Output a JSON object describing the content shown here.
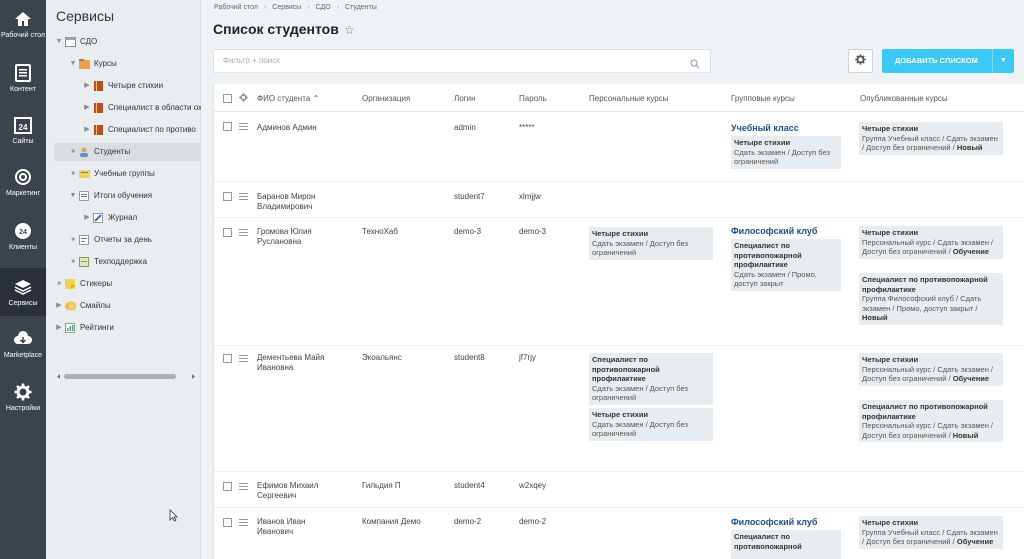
{
  "rail": [
    {
      "label": "Рабочий стол",
      "icon": "home-icon"
    },
    {
      "label": "Контент",
      "icon": "document-icon"
    },
    {
      "label": "Сайты",
      "icon": "calendar-24-icon"
    },
    {
      "label": "Маркетинг",
      "icon": "target-icon"
    },
    {
      "label": "Клиенты",
      "icon": "clients-24-icon"
    },
    {
      "label": "Сервисы",
      "icon": "layers-icon"
    },
    {
      "label": "Marketplace",
      "icon": "cloud-download-icon"
    },
    {
      "label": "Настройки",
      "icon": "gear-icon"
    }
  ],
  "tree": {
    "title": "Сервисы",
    "items": [
      {
        "label": "СДО",
        "icon": "module-icon"
      },
      {
        "label": "Курсы",
        "icon": "folder-icon"
      },
      {
        "label": "Четыре стихии",
        "icon": "book-icon"
      },
      {
        "label": "Специалист в области ох",
        "icon": "book-icon"
      },
      {
        "label": "Специалист по противо",
        "icon": "book-icon"
      },
      {
        "label": "Студенты",
        "icon": "user-icon"
      },
      {
        "label": "Учебные группы",
        "icon": "group-icon"
      },
      {
        "label": "Итоги обучения",
        "icon": "results-icon"
      },
      {
        "label": "Журнал",
        "icon": "journal-icon"
      },
      {
        "label": "Отчеты за день",
        "icon": "report-icon"
      },
      {
        "label": "Техподдержка",
        "icon": "support-icon"
      },
      {
        "label": "Стикеры",
        "icon": "sticker-icon"
      },
      {
        "label": "Смайлы",
        "icon": "smile-icon"
      },
      {
        "label": "Рейтинги",
        "icon": "rating-icon"
      }
    ]
  },
  "breadcrumbs": [
    "Рабочий стол",
    "Сервисы",
    "СДО",
    "Студенты"
  ],
  "page_title": "Список студентов",
  "filter_placeholder": "Фильтр + поиск",
  "add_button": "ДОБАВИТЬ СПИСКОМ",
  "columns": [
    "ФИО студента",
    "Организация",
    "Логин",
    "Пароль",
    "Персональные курсы",
    "Групповые курсы",
    "Опубликованные курсы"
  ],
  "rows": [
    {
      "name": "Админов Админ",
      "org": "",
      "login": "admin",
      "password": "*****",
      "personal": [],
      "group_title": "Учебный класс",
      "group": [
        {
          "title": "Четыре стихии",
          "text": "Сдать экзамен / Доступ без ограничений"
        }
      ],
      "published": [
        {
          "title": "Четыре стихии",
          "text": "Группа Учебный класс / Сдать экзамен / Доступ без ограничений /",
          "status": "Новый"
        }
      ]
    },
    {
      "name": "Баранов Мирон Владимирович",
      "org": "",
      "login": "student7",
      "password": "xlmjjw",
      "personal": [],
      "group_title": "",
      "group": [],
      "published": []
    },
    {
      "name": "Громова Юлия Руслановна",
      "org": "ТехноХаб",
      "login": "demo-3",
      "password": "demo-3",
      "personal": [
        {
          "title": "Четыре стихии",
          "text": "Сдать экзамен / Доступ без ограничений"
        }
      ],
      "group_title": "Философский клуб",
      "group": [
        {
          "title": "Специалист по противопожарной профилактике",
          "text": "Сдать экзамен / Промо, доступ закрыт"
        }
      ],
      "published": [
        {
          "title": "Четыре стихии",
          "text": "Персональный курс / Сдать экзамен / Доступ без ограничений /",
          "status": "Обучение"
        },
        {
          "title": "Специалист по противопожарной профилактике",
          "text": "Группа Философский клуб / Сдать экзамен / Промо, доступ закрыт /",
          "status": "Новый"
        }
      ]
    },
    {
      "name": "Дементьева Майя Ивановна",
      "org": "Экоальянс",
      "login": "student8",
      "password": "jf7rjy",
      "personal": [
        {
          "title": "Специалист по противопожарной профилактике",
          "text": "Сдать экзамен / Доступ без ограничений"
        },
        {
          "title": "Четыре стихии",
          "text": "Сдать экзамен / Доступ без ограничений"
        }
      ],
      "group_title": "",
      "group": [],
      "published": [
        {
          "title": "Четыре стихии",
          "text": "Персональный курс / Сдать экзамен / Доступ без ограничений /",
          "status": "Обучение"
        },
        {
          "title": "Специалист по противопожарной профилактике",
          "text": "Персональный курс / Сдать экзамен / Доступ без ограничений /",
          "status": "Новый"
        }
      ]
    },
    {
      "name": "Ефимов Михаил Сергеевич",
      "org": "Гильдия П",
      "login": "student4",
      "password": "w2xqey",
      "personal": [],
      "group_title": "",
      "group": [],
      "published": []
    },
    {
      "name": "Иванов Иван Иванович",
      "org": "Компания Демо",
      "login": "demo-2",
      "password": "demo-2",
      "personal": [],
      "group_title": "Философский клуб",
      "group": [
        {
          "title": "Специалист по противопожарной",
          "text": ""
        }
      ],
      "published": [
        {
          "title": "Четыре стихии",
          "text": "Группа Учебный класс / Сдать экзамен / Доступ без ограничений /",
          "status": "Обучение"
        }
      ]
    }
  ]
}
